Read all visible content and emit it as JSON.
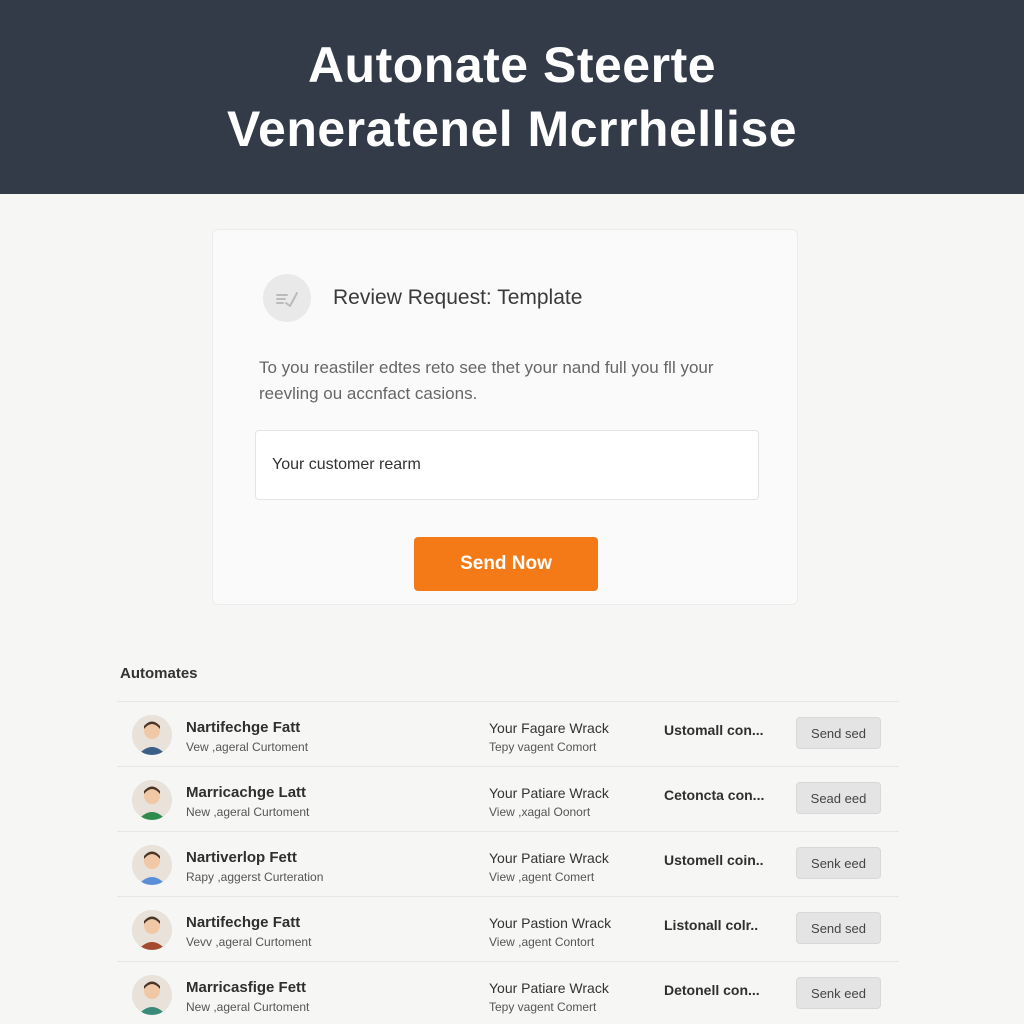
{
  "header": {
    "line1": "Autonate Steerte",
    "line2": "Veneratenel Mcrrhellise",
    "background": "#323b47"
  },
  "card": {
    "icon": "edit-check-icon",
    "title": "Review Request: Template",
    "description": "To you reastiler edtes reto see thet your nand full you fll your reevling ou accnfact casions.",
    "input_value": "Your customer rearm",
    "send_label": "Send Now",
    "accent": "#f47a17"
  },
  "automates": {
    "title": "Automates",
    "rows": [
      {
        "name": "Nartifechge Fatt",
        "sub": "Vew ,ageral Curtoment",
        "col2a": "Your Fagare Wrack",
        "col2b": "Tepy vagent Comort",
        "col3": "Ustomall con...",
        "button": "Send sed",
        "avatar_color": "#3b5f86"
      },
      {
        "name": "Marricachge Latt",
        "sub": "New ,ageral Curtoment",
        "col2a": "Your Patiare Wrack",
        "col2b": "View ,xagal Oonort",
        "col3": "Cetoncta con...",
        "button": "Sead eed",
        "avatar_color": "#2f8a4e"
      },
      {
        "name": "Nartiverlop Fett",
        "sub": "Rapy ,aggerst Curteration",
        "col2a": "Your Patiare Wrack",
        "col2b": "View ,agent Comert",
        "col3": "Ustomell coin..",
        "button": "Senk eed",
        "avatar_color": "#5a8fd8"
      },
      {
        "name": "Nartifechge Fatt",
        "sub": "Vevv ,ageral Curtoment",
        "col2a": "Your Pastion Wrack",
        "col2b": "View ,agent Contort",
        "col3": "Listonall colr..",
        "button": "Send sed",
        "avatar_color": "#a44a2e"
      },
      {
        "name": "Marricasfige Fett",
        "sub": "New ,ageral Curtoment",
        "col2a": "Your Patiare Wrack",
        "col2b": "Tepy vagent Comert",
        "col3": "Detonell con...",
        "button": "Senk eed",
        "avatar_color": "#3a8a7a"
      }
    ]
  }
}
